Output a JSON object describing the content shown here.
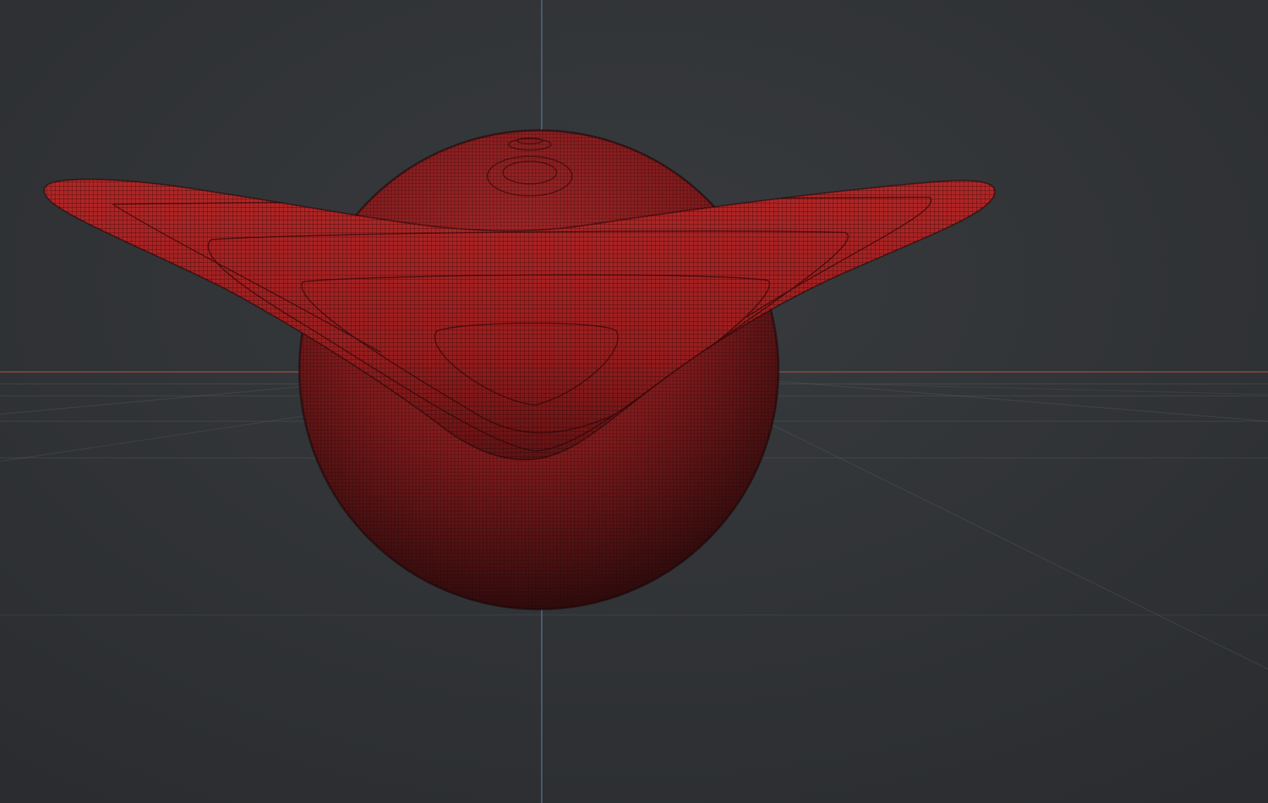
{
  "viewport": {
    "panel": "3d-viewport",
    "background_color": "#2f3134",
    "view": "perspective"
  },
  "axes": {
    "x_axis_color": "#b4504c",
    "z_axis_color": "#5b7aa8",
    "grid_color": "#5a5d62"
  },
  "objects": [
    {
      "name": "sphere-mesh",
      "material_color": "#8e1b1c",
      "display": "wireframe-on-shaded"
    },
    {
      "name": "wing-mesh",
      "material_color": "#a32020",
      "display": "wireframe-on-shaded"
    }
  ]
}
